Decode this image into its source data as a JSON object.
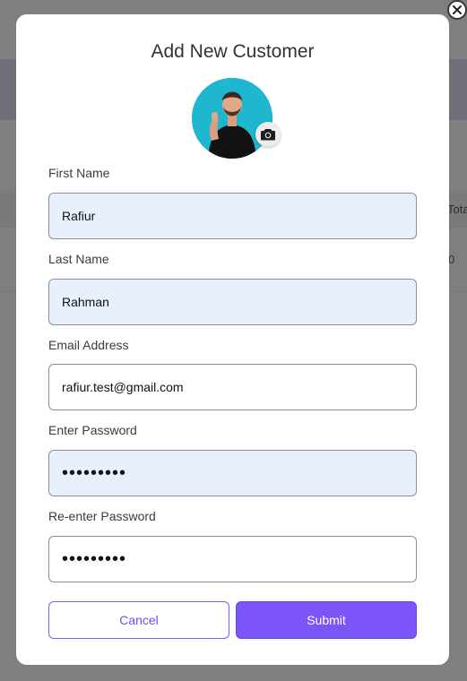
{
  "background": {
    "column_header": "Tota",
    "cell_value": "0"
  },
  "modal": {
    "title": "Add New Customer",
    "avatar_alt": "customer-photo",
    "fields": {
      "first_name": {
        "label": "First Name",
        "value": "Rafiur"
      },
      "last_name": {
        "label": "Last Name",
        "value": "Rahman"
      },
      "email": {
        "label": "Email Address",
        "value": "rafiur.test@gmail.com"
      },
      "password": {
        "label": "Enter Password",
        "value": "•••••••••"
      },
      "password_confirm": {
        "label": "Re-enter Password",
        "value": "•••••••••"
      }
    },
    "buttons": {
      "cancel": "Cancel",
      "submit": "Submit"
    }
  },
  "colors": {
    "accent": "#7b55f7",
    "autofill_bg": "#e8f0fe",
    "avatar_bg": "#1fb6cf"
  },
  "icons": [
    "close-icon",
    "camera-icon"
  ]
}
